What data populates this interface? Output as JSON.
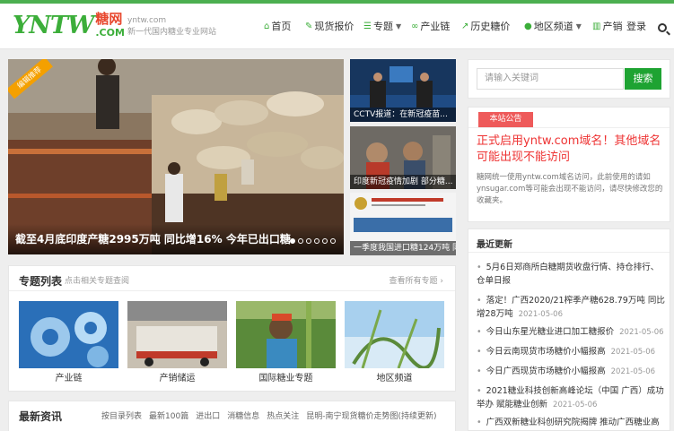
{
  "header": {
    "logo_text": "YNTW",
    "logo_cn": "糖网",
    "logo_com": ".COM",
    "site_domain": "yntw.com",
    "site_tagline": "新一代国内糖业专业网站",
    "nav": [
      {
        "label": "首页",
        "icon": "home-icon",
        "dropdown": false
      },
      {
        "label": "现货报价",
        "icon": "edit-icon",
        "dropdown": false
      },
      {
        "label": "专题",
        "icon": "list-icon",
        "dropdown": true
      },
      {
        "label": "产业链",
        "icon": "link-icon",
        "dropdown": false
      },
      {
        "label": "历史糖价",
        "icon": "chart-icon",
        "dropdown": false
      },
      {
        "label": "地区频道",
        "icon": "location-icon",
        "dropdown": true
      },
      {
        "label": "产销",
        "icon": "bar-chart-icon",
        "dropdown": false
      },
      {
        "label": "登录",
        "icon": "",
        "dropdown": false
      }
    ]
  },
  "slider": {
    "badge": "编辑推荐",
    "caption": "截至4月底印度产糖2995万吨 同比增16% 今年已出口糖",
    "dots": 6,
    "active_dot": 1
  },
  "side_thumbs": [
    {
      "caption": "CCTV报道：在新冠疫苗..."
    },
    {
      "caption": "印度新冠疫情加剧 部分糖..."
    },
    {
      "caption": "一季度我国进口糖124万吨 同比"
    }
  ],
  "topics": {
    "title": "专题列表",
    "hint": "点击相关专题查阅",
    "view_all": "查看所有专题 ›",
    "items": [
      {
        "label": "产业链"
      },
      {
        "label": "产销储运"
      },
      {
        "label": "国际糖业专题"
      },
      {
        "label": "地区频道"
      }
    ]
  },
  "news": {
    "title": "最新资讯",
    "tabs": [
      "按目录列表",
      "最新100篇",
      "进出口",
      "消糖信息",
      "热点关注",
      "昆明-南宁现货糖价走势图(持续更新)"
    ]
  },
  "search": {
    "placeholder": "请输入关键词",
    "button": "搜索"
  },
  "notice": {
    "tag": "本站公告",
    "headline": "正式启用yntw.com域名！其他域名可能出现不能访问",
    "body": "糖网统一使用yntw.com域名访问，此前使用的请如ynsugar.com等可能会出现不能访问，请尽快修改您的收藏夹。"
  },
  "recent": {
    "title": "最近更新",
    "items": [
      {
        "text": "5月6日郑商所白糖期货收盘行情、持仓排行、仓单日报",
        "date": "2021-05-06"
      },
      {
        "text": "落定！广西2020/21榨季产糖628.79万吨 同比增28万吨",
        "date": "2021-05-06"
      },
      {
        "text": "今日山东星光糖业进口加工糖报价",
        "date": "2021-05-06"
      },
      {
        "text": "今日云南现货市场糖价小幅报高",
        "date": "2021-05-06"
      },
      {
        "text": "今日广西现货市场糖价小幅报高",
        "date": "2021-05-06"
      },
      {
        "text": "2021糖业科技创新高峰论坛（中国 广西）成功举办 赋能糖业创新",
        "date": "2021-05-06"
      },
      {
        "text": "广西双新糖业科创研究院揭牌 推动广西糖业高",
        "date": ""
      }
    ]
  }
}
